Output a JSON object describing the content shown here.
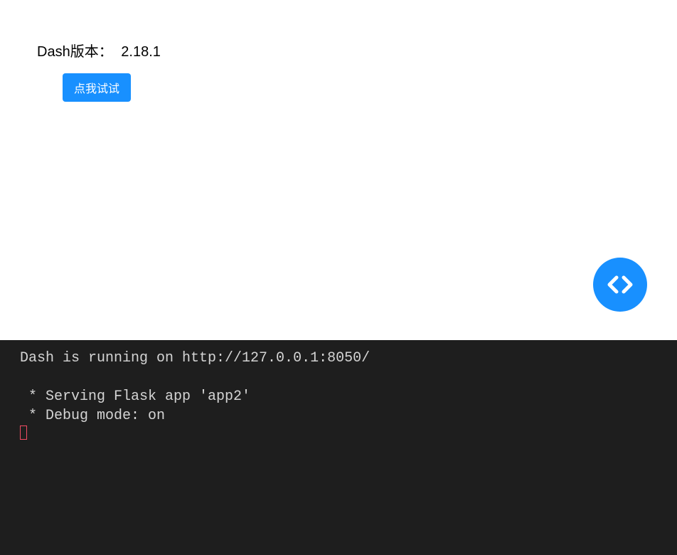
{
  "app": {
    "version_label": "Dash版本：",
    "version_value": "2.18.1",
    "try_button_label": "点我试试"
  },
  "dev_tools": {
    "icon_name": "code-icon"
  },
  "terminal": {
    "line1": "Dash is running on http://127.0.0.1:8050/",
    "line2": " * Serving Flask app 'app2'",
    "line3": " * Debug mode: on"
  }
}
